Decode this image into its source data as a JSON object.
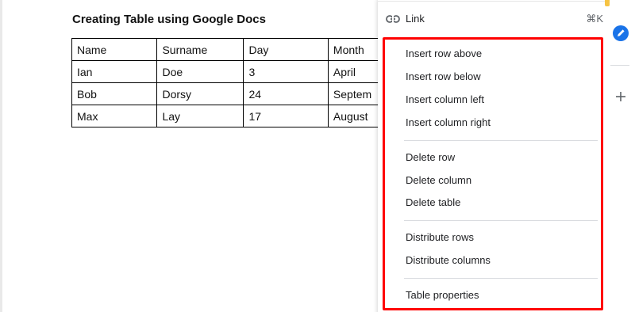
{
  "document": {
    "title": "Creating Table using Google Docs",
    "table": {
      "rows": [
        [
          "Name",
          "Surname",
          "Day",
          "Month"
        ],
        [
          "Ian",
          "Doe",
          "3",
          "April"
        ],
        [
          "Bob",
          "Dorsy",
          "24",
          "Septem"
        ],
        [
          "Max",
          "Lay",
          "17",
          "August"
        ]
      ]
    }
  },
  "menu": {
    "link": {
      "label": "Link",
      "shortcut": "⌘K",
      "icon": "link-icon"
    },
    "insert_row_above": "Insert row above",
    "insert_row_below": "Insert row below",
    "insert_column_left": "Insert column left",
    "insert_column_right": "Insert column right",
    "delete_row": "Delete row",
    "delete_column": "Delete column",
    "delete_table": "Delete table",
    "distribute_rows": "Distribute rows",
    "distribute_columns": "Distribute columns",
    "table_properties": "Table properties"
  },
  "sidebar": {
    "icons": [
      "keep-icon",
      "tasks-icon",
      "add-icon"
    ]
  },
  "colors": {
    "highlight": "#ff0000",
    "tasks_blue": "#1a73e8",
    "keep_yellow": "#f6c343"
  }
}
